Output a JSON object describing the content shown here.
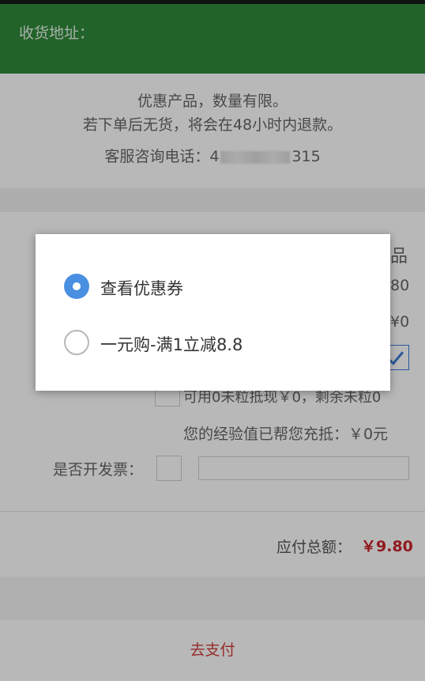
{
  "header": {
    "label": "收货地址："
  },
  "notice": {
    "line1": "优惠产品，数量有限。",
    "line2": "若下单后无货，将会在48小时内退款。",
    "phone_label": "客服咨询电话：",
    "phone_prefix": "4",
    "phone_suffix": "315"
  },
  "product": {
    "title_partial": "品",
    "price_partial": "80",
    "discount_partial": "¥0",
    "points_text": "可用0未粒抵现￥0，剩余未粒0",
    "experience_text": "您的经验值已帮您充抵：￥0元",
    "invoice_label": "是否开发票："
  },
  "total": {
    "label": "应付总额：",
    "amount": "￥9.80",
    "amount_color": "#c9242b"
  },
  "pay_button": {
    "label": "去支付"
  },
  "dialog": {
    "options": [
      {
        "label": "查看优惠券",
        "selected": true
      },
      {
        "label": "一元购-满1立减8.8",
        "selected": false
      }
    ]
  },
  "colors": {
    "header_bg": "#2f8a39",
    "radio_selected": "#4a90e2",
    "pay_text": "#d23c3c"
  }
}
